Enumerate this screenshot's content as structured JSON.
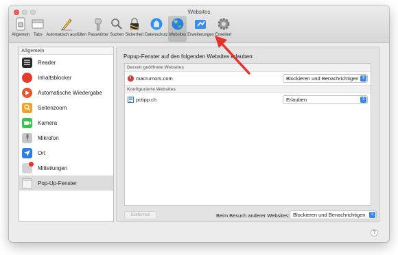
{
  "window": {
    "title": "Websites"
  },
  "toolbar": {
    "items": [
      {
        "label": "Allgemein",
        "icon": "switch-icon"
      },
      {
        "label": "Tabs",
        "icon": "tabs-icon"
      },
      {
        "label": "Automatisch ausfüllen",
        "icon": "pencil-icon"
      },
      {
        "label": "Passwörter",
        "icon": "key-icon"
      },
      {
        "label": "Suchen",
        "icon": "magnifier-icon"
      },
      {
        "label": "Sicherheit",
        "icon": "lock-icon"
      },
      {
        "label": "Datenschutz",
        "icon": "hand-icon"
      },
      {
        "label": "Websites",
        "icon": "globe-icon",
        "active": true
      },
      {
        "label": "Erweiterungen",
        "icon": "puzzle-icon"
      },
      {
        "label": "Erweitert",
        "icon": "gear-icon"
      }
    ]
  },
  "sidebar": {
    "header": "Allgemein",
    "items": [
      {
        "label": "Reader"
      },
      {
        "label": "Inhaltsblocker"
      },
      {
        "label": "Automatische Wiedergabe"
      },
      {
        "label": "Seitenzoom"
      },
      {
        "label": "Kamera"
      },
      {
        "label": "Mikrofon"
      },
      {
        "label": "Ort"
      },
      {
        "label": "Mitteilungen"
      },
      {
        "label": "Pop-Up-Fenster",
        "selected": true
      }
    ]
  },
  "main": {
    "title": "Popup-Fenster auf den folgenden Websites erlauben:",
    "sections": [
      {
        "header": "Derzeit geöffnete Websites",
        "rows": [
          {
            "site": "macrumors.com",
            "setting": "Blockieren und Benachrichtigen"
          }
        ]
      },
      {
        "header": "Konfigurierte Websites",
        "rows": [
          {
            "site": "pctipp.ch",
            "setting": "Erlauben"
          }
        ]
      }
    ],
    "remove_button": "Entfernen",
    "other_sites_label": "Beim Besuch anderer Websites:",
    "other_sites_setting": "Blockieren und Benachrichtigen"
  },
  "help": {
    "label": "?"
  },
  "colors": {
    "accent": "#3b84f5",
    "annotation_arrow": "#e8312a",
    "close_button": "#fc5f57"
  }
}
